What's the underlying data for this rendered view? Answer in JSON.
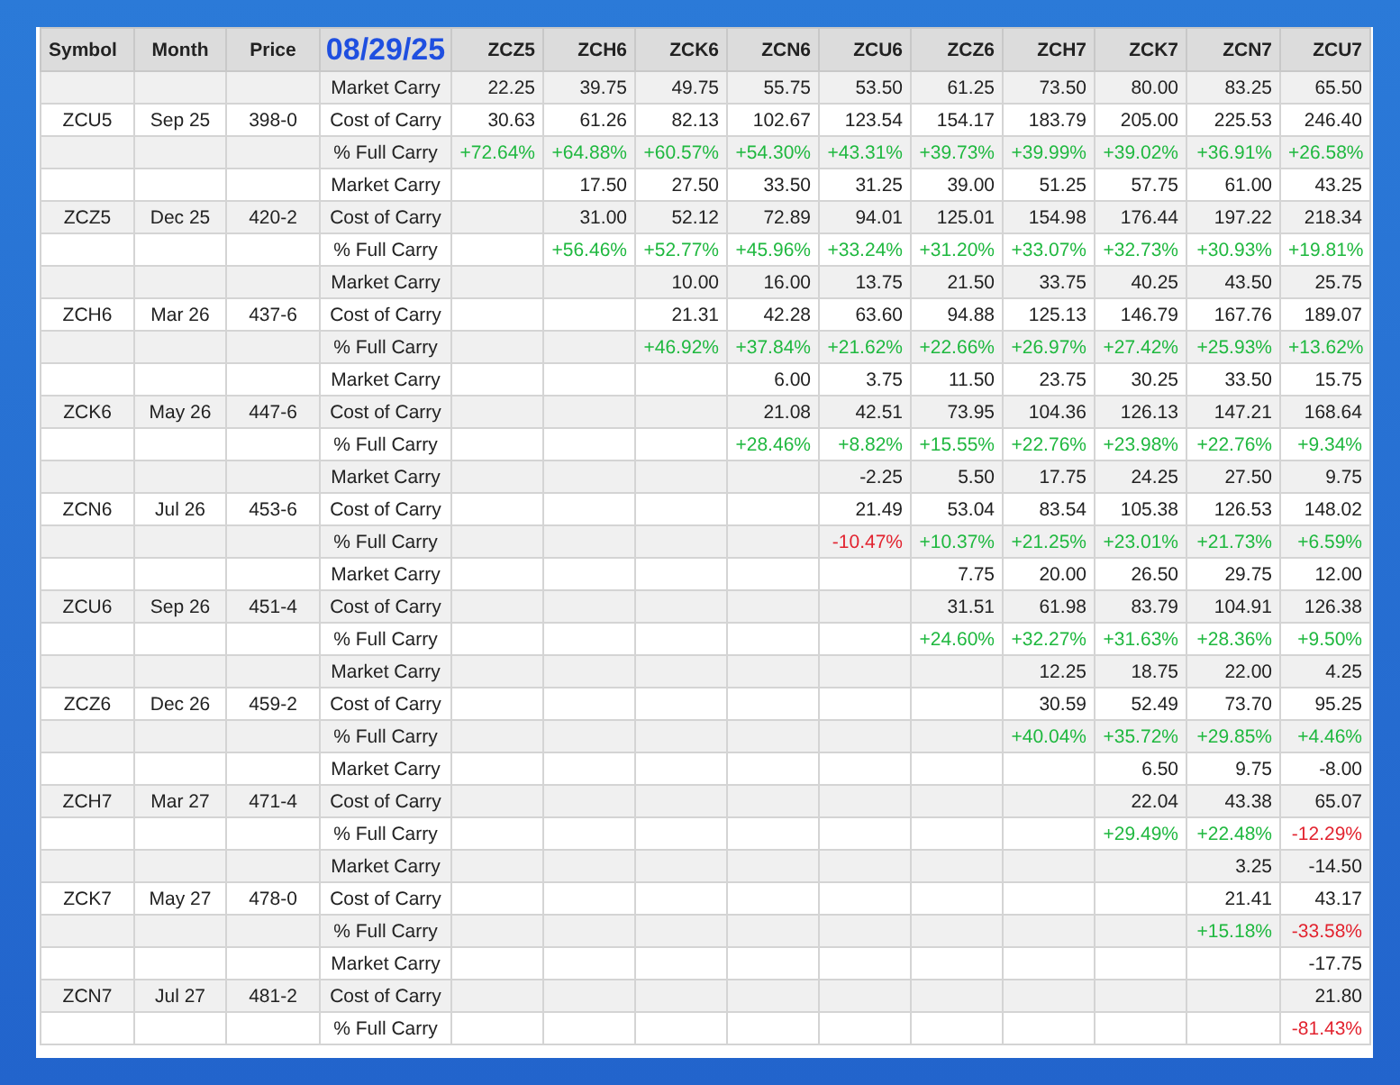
{
  "table": {
    "columns": [
      "Symbol",
      "Month",
      "Price"
    ],
    "date": "08/29/25",
    "contracts": [
      "ZCZ5",
      "ZCH6",
      "ZCK6",
      "ZCN6",
      "ZCU6",
      "ZCZ6",
      "ZCH7",
      "ZCK7",
      "ZCN7",
      "ZCU7"
    ],
    "rows": [
      {
        "label": "Market Carry",
        "cells": [
          "22.25",
          "39.75",
          "49.75",
          "55.75",
          "53.50",
          "61.25",
          "73.50",
          "80.00",
          "83.25",
          "65.50"
        ]
      },
      {
        "symbol": "ZCU5",
        "month": "Sep 25",
        "price": "398-0",
        "label": "Cost of Carry",
        "cells": [
          "30.63",
          "61.26",
          "82.13",
          "102.67",
          "123.54",
          "154.17",
          "183.79",
          "205.00",
          "225.53",
          "246.40"
        ]
      },
      {
        "label": "% Full Carry",
        "cells": [
          {
            "text": "+72.64%",
            "negative": false
          },
          {
            "text": "+64.88%",
            "negative": false
          },
          {
            "text": "+60.57%",
            "negative": false
          },
          {
            "text": "+54.30%",
            "negative": false
          },
          {
            "text": "+43.31%",
            "negative": false
          },
          {
            "text": "+39.73%",
            "negative": false
          },
          {
            "text": "+39.99%",
            "negative": false
          },
          {
            "text": "+39.02%",
            "negative": false
          },
          {
            "text": "+36.91%",
            "negative": false
          },
          {
            "text": "+26.58%",
            "negative": false
          }
        ]
      },
      {
        "label": "Market Carry",
        "cells": [
          null,
          "17.50",
          "27.50",
          "33.50",
          "31.25",
          "39.00",
          "51.25",
          "57.75",
          "61.00",
          "43.25"
        ]
      },
      {
        "symbol": "ZCZ5",
        "month": "Dec 25",
        "price": "420-2",
        "label": "Cost of Carry",
        "cells": [
          null,
          "31.00",
          "52.12",
          "72.89",
          "94.01",
          "125.01",
          "154.98",
          "176.44",
          "197.22",
          "218.34"
        ]
      },
      {
        "label": "% Full Carry",
        "cells": [
          null,
          {
            "text": "+56.46%",
            "negative": false
          },
          {
            "text": "+52.77%",
            "negative": false
          },
          {
            "text": "+45.96%",
            "negative": false
          },
          {
            "text": "+33.24%",
            "negative": false
          },
          {
            "text": "+31.20%",
            "negative": false
          },
          {
            "text": "+33.07%",
            "negative": false
          },
          {
            "text": "+32.73%",
            "negative": false
          },
          {
            "text": "+30.93%",
            "negative": false
          },
          {
            "text": "+19.81%",
            "negative": false
          }
        ]
      },
      {
        "label": "Market Carry",
        "cells": [
          null,
          null,
          "10.00",
          "16.00",
          "13.75",
          "21.50",
          "33.75",
          "40.25",
          "43.50",
          "25.75"
        ]
      },
      {
        "symbol": "ZCH6",
        "month": "Mar 26",
        "price": "437-6",
        "label": "Cost of Carry",
        "cells": [
          null,
          null,
          "21.31",
          "42.28",
          "63.60",
          "94.88",
          "125.13",
          "146.79",
          "167.76",
          "189.07"
        ]
      },
      {
        "label": "% Full Carry",
        "cells": [
          null,
          null,
          {
            "text": "+46.92%",
            "negative": false
          },
          {
            "text": "+37.84%",
            "negative": false
          },
          {
            "text": "+21.62%",
            "negative": false
          },
          {
            "text": "+22.66%",
            "negative": false
          },
          {
            "text": "+26.97%",
            "negative": false
          },
          {
            "text": "+27.42%",
            "negative": false
          },
          {
            "text": "+25.93%",
            "negative": false
          },
          {
            "text": "+13.62%",
            "negative": false
          }
        ]
      },
      {
        "label": "Market Carry",
        "cells": [
          null,
          null,
          null,
          "6.00",
          "3.75",
          "11.50",
          "23.75",
          "30.25",
          "33.50",
          "15.75"
        ]
      },
      {
        "symbol": "ZCK6",
        "month": "May 26",
        "price": "447-6",
        "label": "Cost of Carry",
        "cells": [
          null,
          null,
          null,
          "21.08",
          "42.51",
          "73.95",
          "104.36",
          "126.13",
          "147.21",
          "168.64"
        ]
      },
      {
        "label": "% Full Carry",
        "cells": [
          null,
          null,
          null,
          {
            "text": "+28.46%",
            "negative": false
          },
          {
            "text": "+8.82%",
            "negative": false
          },
          {
            "text": "+15.55%",
            "negative": false
          },
          {
            "text": "+22.76%",
            "negative": false
          },
          {
            "text": "+23.98%",
            "negative": false
          },
          {
            "text": "+22.76%",
            "negative": false
          },
          {
            "text": "+9.34%",
            "negative": false
          }
        ]
      },
      {
        "label": "Market Carry",
        "cells": [
          null,
          null,
          null,
          null,
          "-2.25",
          "5.50",
          "17.75",
          "24.25",
          "27.50",
          "9.75"
        ]
      },
      {
        "symbol": "ZCN6",
        "month": "Jul 26",
        "price": "453-6",
        "label": "Cost of Carry",
        "cells": [
          null,
          null,
          null,
          null,
          "21.49",
          "53.04",
          "83.54",
          "105.38",
          "126.53",
          "148.02"
        ]
      },
      {
        "label": "% Full Carry",
        "cells": [
          null,
          null,
          null,
          null,
          {
            "text": "-10.47%",
            "negative": true
          },
          {
            "text": "+10.37%",
            "negative": false
          },
          {
            "text": "+21.25%",
            "negative": false
          },
          {
            "text": "+23.01%",
            "negative": false
          },
          {
            "text": "+21.73%",
            "negative": false
          },
          {
            "text": "+6.59%",
            "negative": false
          }
        ]
      },
      {
        "label": "Market Carry",
        "cells": [
          null,
          null,
          null,
          null,
          null,
          "7.75",
          "20.00",
          "26.50",
          "29.75",
          "12.00"
        ]
      },
      {
        "symbol": "ZCU6",
        "month": "Sep 26",
        "price": "451-4",
        "label": "Cost of Carry",
        "cells": [
          null,
          null,
          null,
          null,
          null,
          "31.51",
          "61.98",
          "83.79",
          "104.91",
          "126.38"
        ]
      },
      {
        "label": "% Full Carry",
        "cells": [
          null,
          null,
          null,
          null,
          null,
          {
            "text": "+24.60%",
            "negative": false
          },
          {
            "text": "+32.27%",
            "negative": false
          },
          {
            "text": "+31.63%",
            "negative": false
          },
          {
            "text": "+28.36%",
            "negative": false
          },
          {
            "text": "+9.50%",
            "negative": false
          }
        ]
      },
      {
        "label": "Market Carry",
        "cells": [
          null,
          null,
          null,
          null,
          null,
          null,
          "12.25",
          "18.75",
          "22.00",
          "4.25"
        ]
      },
      {
        "symbol": "ZCZ6",
        "month": "Dec 26",
        "price": "459-2",
        "label": "Cost of Carry",
        "cells": [
          null,
          null,
          null,
          null,
          null,
          null,
          "30.59",
          "52.49",
          "73.70",
          "95.25"
        ]
      },
      {
        "label": "% Full Carry",
        "cells": [
          null,
          null,
          null,
          null,
          null,
          null,
          {
            "text": "+40.04%",
            "negative": false
          },
          {
            "text": "+35.72%",
            "negative": false
          },
          {
            "text": "+29.85%",
            "negative": false
          },
          {
            "text": "+4.46%",
            "negative": false
          }
        ]
      },
      {
        "label": "Market Carry",
        "cells": [
          null,
          null,
          null,
          null,
          null,
          null,
          null,
          "6.50",
          "9.75",
          "-8.00"
        ]
      },
      {
        "symbol": "ZCH7",
        "month": "Mar 27",
        "price": "471-4",
        "label": "Cost of Carry",
        "cells": [
          null,
          null,
          null,
          null,
          null,
          null,
          null,
          "22.04",
          "43.38",
          "65.07"
        ]
      },
      {
        "label": "% Full Carry",
        "cells": [
          null,
          null,
          null,
          null,
          null,
          null,
          null,
          {
            "text": "+29.49%",
            "negative": false
          },
          {
            "text": "+22.48%",
            "negative": false
          },
          {
            "text": "-12.29%",
            "negative": true
          }
        ]
      },
      {
        "label": "Market Carry",
        "cells": [
          null,
          null,
          null,
          null,
          null,
          null,
          null,
          null,
          "3.25",
          "-14.50"
        ]
      },
      {
        "symbol": "ZCK7",
        "month": "May 27",
        "price": "478-0",
        "label": "Cost of Carry",
        "cells": [
          null,
          null,
          null,
          null,
          null,
          null,
          null,
          null,
          "21.41",
          "43.17"
        ]
      },
      {
        "label": "% Full Carry",
        "cells": [
          null,
          null,
          null,
          null,
          null,
          null,
          null,
          null,
          {
            "text": "+15.18%",
            "negative": false
          },
          {
            "text": "-33.58%",
            "negative": true
          }
        ]
      },
      {
        "label": "Market Carry",
        "cells": [
          null,
          null,
          null,
          null,
          null,
          null,
          null,
          null,
          null,
          "-17.75"
        ]
      },
      {
        "symbol": "ZCN7",
        "month": "Jul 27",
        "price": "481-2",
        "label": "Cost of Carry",
        "cells": [
          null,
          null,
          null,
          null,
          null,
          null,
          null,
          null,
          null,
          "21.80"
        ]
      },
      {
        "label": "% Full Carry",
        "cells": [
          null,
          null,
          null,
          null,
          null,
          null,
          null,
          null,
          null,
          {
            "text": "-81.43%",
            "negative": true
          }
        ]
      }
    ]
  }
}
